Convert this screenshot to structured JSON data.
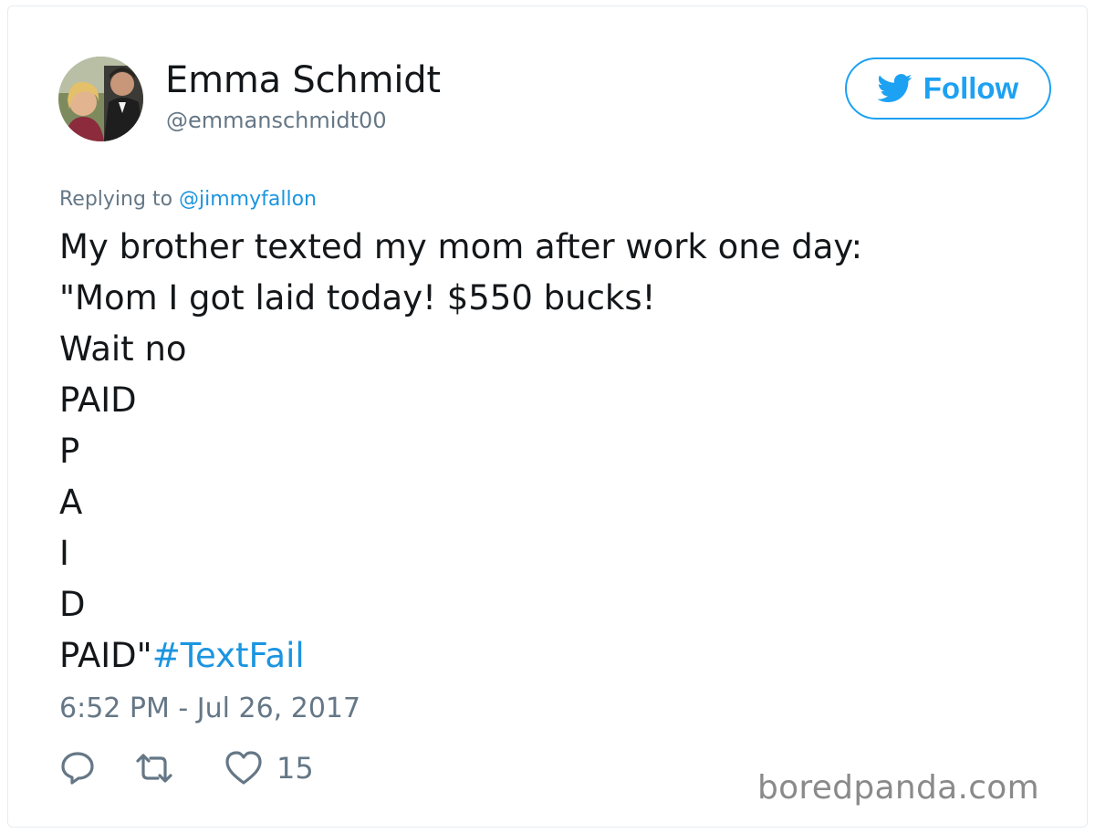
{
  "profile": {
    "name": "Emma Schmidt",
    "handle": "@emmanschmidt00",
    "avatar_icon": "avatar-photo"
  },
  "follow_button": {
    "label": "Follow",
    "icon": "twitter-bird-icon",
    "accent": "#1da1f2"
  },
  "reply": {
    "prefix": "Replying to ",
    "mention": "@jimmyfallon"
  },
  "tweet": {
    "lines": [
      "My brother texted my mom after work one day:",
      "\"Mom I got laid today! $550 bucks!",
      "Wait no",
      "PAID",
      "P",
      "A",
      "I",
      "D"
    ],
    "last_line_text": "PAID\"",
    "hashtag": "#TextFail"
  },
  "timestamp": "6:52 PM - Jul 26, 2017",
  "actions": {
    "reply_icon": "reply-icon",
    "retweet_icon": "retweet-icon",
    "like_icon": "heart-icon",
    "like_count": "15"
  },
  "watermark": "boredpanda.com",
  "colors": {
    "text": "#14171a",
    "muted": "#657786",
    "link": "#1b95e0",
    "brand": "#1da1f2"
  }
}
